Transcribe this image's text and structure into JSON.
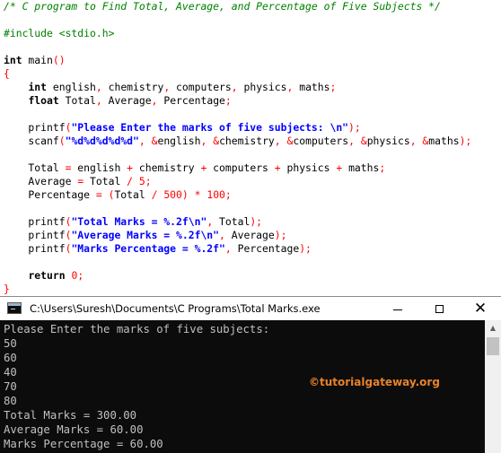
{
  "editor": {
    "lines": [
      [
        {
          "c": "t-com",
          "t": "/* C program to Find Total, Average, and Percentage of Five Subjects */"
        }
      ],
      [],
      [
        {
          "c": "t-pp",
          "t": "#include <stdio.h>"
        }
      ],
      [],
      [
        {
          "c": "t-kw",
          "t": "int"
        },
        {
          "c": "t-id",
          "t": " main"
        },
        {
          "c": "t-op",
          "t": "()"
        }
      ],
      [
        {
          "c": "t-op",
          "t": "{"
        }
      ],
      [
        {
          "c": "t-id",
          "t": "    "
        },
        {
          "c": "t-kw",
          "t": "int"
        },
        {
          "c": "t-id",
          "t": " english"
        },
        {
          "c": "t-op",
          "t": ","
        },
        {
          "c": "t-id",
          "t": " chemistry"
        },
        {
          "c": "t-op",
          "t": ","
        },
        {
          "c": "t-id",
          "t": " computers"
        },
        {
          "c": "t-op",
          "t": ","
        },
        {
          "c": "t-id",
          "t": " physics"
        },
        {
          "c": "t-op",
          "t": ","
        },
        {
          "c": "t-id",
          "t": " maths"
        },
        {
          "c": "t-op",
          "t": ";"
        }
      ],
      [
        {
          "c": "t-id",
          "t": "    "
        },
        {
          "c": "t-kw",
          "t": "float"
        },
        {
          "c": "t-id",
          "t": " Total"
        },
        {
          "c": "t-op",
          "t": ","
        },
        {
          "c": "t-id",
          "t": " Average"
        },
        {
          "c": "t-op",
          "t": ","
        },
        {
          "c": "t-id",
          "t": " Percentage"
        },
        {
          "c": "t-op",
          "t": ";"
        }
      ],
      [],
      [
        {
          "c": "t-id",
          "t": "    printf"
        },
        {
          "c": "t-op",
          "t": "("
        },
        {
          "c": "t-str",
          "t": "\"Please Enter the marks of five subjects: \\n\""
        },
        {
          "c": "t-op",
          "t": ");"
        }
      ],
      [
        {
          "c": "t-id",
          "t": "    scanf"
        },
        {
          "c": "t-op",
          "t": "("
        },
        {
          "c": "t-str",
          "t": "\"%d%d%d%d%d\""
        },
        {
          "c": "t-op",
          "t": ", &"
        },
        {
          "c": "t-id",
          "t": "english"
        },
        {
          "c": "t-op",
          "t": ", &"
        },
        {
          "c": "t-id",
          "t": "chemistry"
        },
        {
          "c": "t-op",
          "t": ", &"
        },
        {
          "c": "t-id",
          "t": "computers"
        },
        {
          "c": "t-op",
          "t": ", &"
        },
        {
          "c": "t-id",
          "t": "physics"
        },
        {
          "c": "t-op",
          "t": ", &"
        },
        {
          "c": "t-id",
          "t": "maths"
        },
        {
          "c": "t-op",
          "t": ");"
        }
      ],
      [],
      [
        {
          "c": "t-id",
          "t": "    Total "
        },
        {
          "c": "t-op",
          "t": "="
        },
        {
          "c": "t-id",
          "t": " english "
        },
        {
          "c": "t-op",
          "t": "+"
        },
        {
          "c": "t-id",
          "t": " chemistry "
        },
        {
          "c": "t-op",
          "t": "+"
        },
        {
          "c": "t-id",
          "t": " computers "
        },
        {
          "c": "t-op",
          "t": "+"
        },
        {
          "c": "t-id",
          "t": " physics "
        },
        {
          "c": "t-op",
          "t": "+"
        },
        {
          "c": "t-id",
          "t": " maths"
        },
        {
          "c": "t-op",
          "t": ";"
        }
      ],
      [
        {
          "c": "t-id",
          "t": "    Average "
        },
        {
          "c": "t-op",
          "t": "="
        },
        {
          "c": "t-id",
          "t": " Total "
        },
        {
          "c": "t-op",
          "t": "/"
        },
        {
          "c": "t-id",
          "t": " "
        },
        {
          "c": "t-num",
          "t": "5"
        },
        {
          "c": "t-op",
          "t": ";"
        }
      ],
      [
        {
          "c": "t-id",
          "t": "    Percentage "
        },
        {
          "c": "t-op",
          "t": "= ("
        },
        {
          "c": "t-id",
          "t": "Total "
        },
        {
          "c": "t-op",
          "t": "/"
        },
        {
          "c": "t-id",
          "t": " "
        },
        {
          "c": "t-num",
          "t": "500"
        },
        {
          "c": "t-op",
          "t": ") *"
        },
        {
          "c": "t-id",
          "t": " "
        },
        {
          "c": "t-num",
          "t": "100"
        },
        {
          "c": "t-op",
          "t": ";"
        }
      ],
      [],
      [
        {
          "c": "t-id",
          "t": "    printf"
        },
        {
          "c": "t-op",
          "t": "("
        },
        {
          "c": "t-str",
          "t": "\"Total Marks = %.2f\\n\""
        },
        {
          "c": "t-op",
          "t": ","
        },
        {
          "c": "t-id",
          "t": " Total"
        },
        {
          "c": "t-op",
          "t": ");"
        }
      ],
      [
        {
          "c": "t-id",
          "t": "    printf"
        },
        {
          "c": "t-op",
          "t": "("
        },
        {
          "c": "t-str",
          "t": "\"Average Marks = %.2f\\n\""
        },
        {
          "c": "t-op",
          "t": ","
        },
        {
          "c": "t-id",
          "t": " Average"
        },
        {
          "c": "t-op",
          "t": ");"
        }
      ],
      [
        {
          "c": "t-id",
          "t": "    printf"
        },
        {
          "c": "t-op",
          "t": "("
        },
        {
          "c": "t-str",
          "t": "\"Marks Percentage = %.2f\""
        },
        {
          "c": "t-op",
          "t": ","
        },
        {
          "c": "t-id",
          "t": " Percentage"
        },
        {
          "c": "t-op",
          "t": ");"
        }
      ],
      [],
      [
        {
          "c": "t-id",
          "t": "    "
        },
        {
          "c": "t-kw",
          "t": "return"
        },
        {
          "c": "t-id",
          "t": " "
        },
        {
          "c": "t-num",
          "t": "0"
        },
        {
          "c": "t-op",
          "t": ";"
        }
      ],
      [
        {
          "c": "t-op",
          "t": "}"
        }
      ]
    ]
  },
  "console": {
    "title": "C:\\Users\\Suresh\\Documents\\C Programs\\Total Marks.exe",
    "minimize_icon": "minimize-icon",
    "maximize_icon": "maximize-icon",
    "close_icon": "close-icon",
    "close_glyph": "✕",
    "scroll_up_glyph": "▲",
    "output_lines": [
      "Please Enter the marks of five subjects:",
      "50",
      "60",
      "40",
      "70",
      "80",
      "Total Marks = 300.00",
      "Average Marks = 60.00",
      "Marks Percentage = 60.00"
    ],
    "watermark": "©tutorialgateway.org"
  },
  "colors": {
    "comment": "#008000",
    "operator": "#ff0000",
    "string": "#0000ff",
    "console_bg": "#0c0c0c",
    "console_text": "#c0c0c0",
    "watermark": "#e8822c"
  }
}
